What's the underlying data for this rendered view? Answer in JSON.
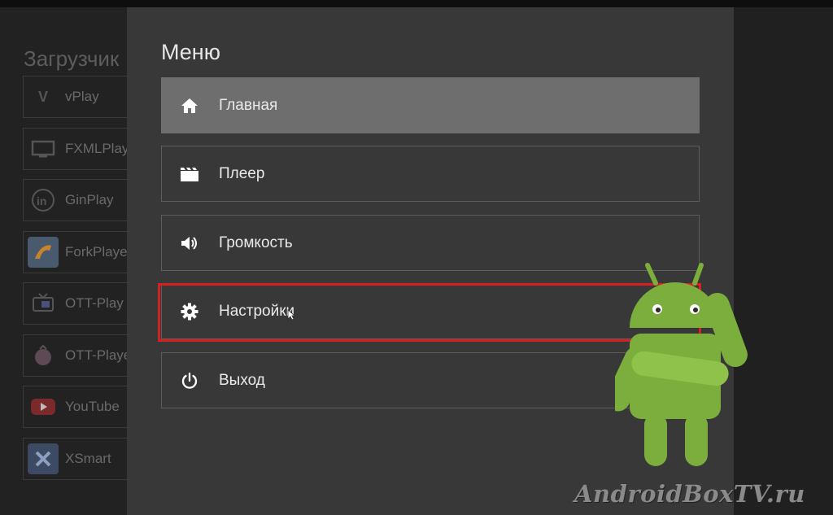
{
  "background": {
    "title": "Загрузчик",
    "apps": [
      {
        "label": "vPlay",
        "icon": "vplay-icon"
      },
      {
        "label": "FXMLPlay",
        "icon": "tv-icon"
      },
      {
        "label": "GinPlay",
        "icon": "ginplay-icon"
      },
      {
        "label": "ForkPlaye",
        "icon": "forkplayer-icon"
      },
      {
        "label": "OTT-Play",
        "icon": "ott-play-icon"
      },
      {
        "label": "OTT-Playe",
        "icon": "ott-player-icon"
      },
      {
        "label": "YouTube",
        "icon": "youtube-icon"
      },
      {
        "label": "XSmart",
        "icon": "xsmart-icon"
      }
    ]
  },
  "menu": {
    "title": "Меню",
    "items": [
      {
        "label": "Главная",
        "icon": "home-icon"
      },
      {
        "label": "Плеер",
        "icon": "clapperboard-icon"
      },
      {
        "label": "Громкость",
        "icon": "volume-icon"
      },
      {
        "label": "Настройки",
        "icon": "gear-icon"
      },
      {
        "label": "Выход",
        "icon": "power-icon"
      }
    ],
    "selected_index": 0,
    "highlighted_index": 3
  },
  "colors": {
    "highlight": "#d62020",
    "android_green": "#7cae3d"
  },
  "watermark": "AndroidBoxTV.ru"
}
